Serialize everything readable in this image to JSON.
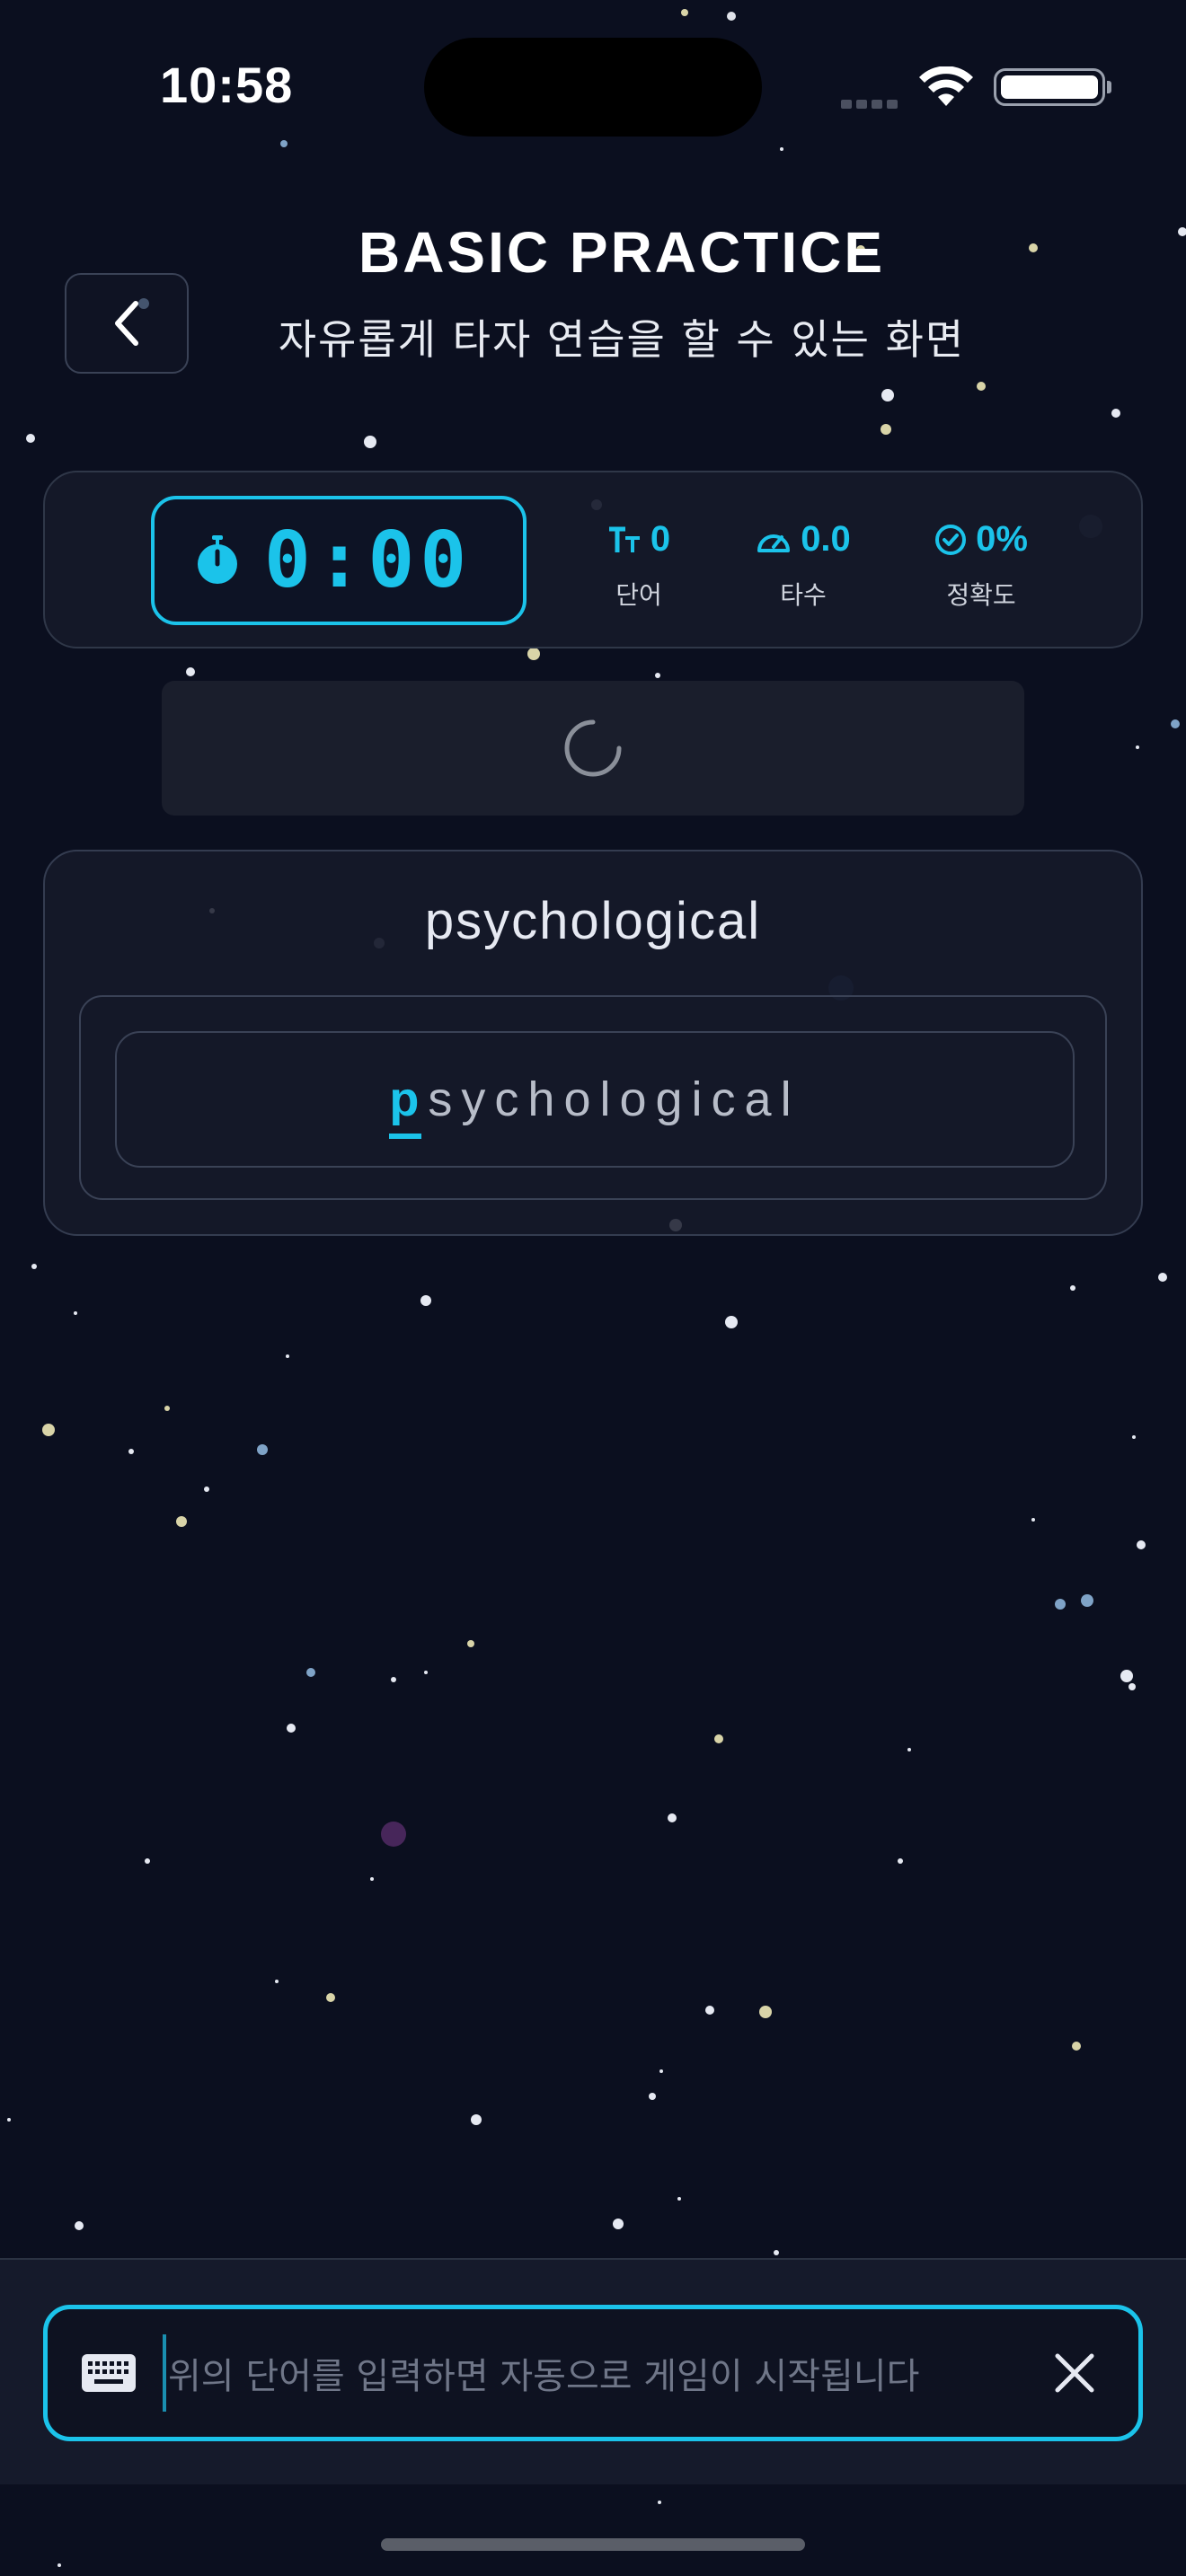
{
  "status_bar": {
    "time": "10:58"
  },
  "header": {
    "title": "BASIC PRACTICE",
    "subtitle": "자유롭게 타자 연습을 할 수 있는 화면",
    "back_icon": "chevron-left-icon"
  },
  "stats": {
    "timer": "0:00",
    "words_value": "0",
    "words_label": "단어",
    "speed_value": "0.0",
    "speed_label": "타수",
    "accuracy_value": "0%",
    "accuracy_label": "정확도"
  },
  "practice": {
    "target_word": "psychological",
    "typing_current_char": "p",
    "typing_remaining": "sychological"
  },
  "input": {
    "placeholder": "위의 단어를 입력하면 자동으로 게임이 시작됩니다",
    "value": ""
  },
  "colors": {
    "background": "#0b0f1f",
    "accent": "#1bc3ea",
    "card": "#161a2a",
    "muted_text": "#6f7688"
  }
}
